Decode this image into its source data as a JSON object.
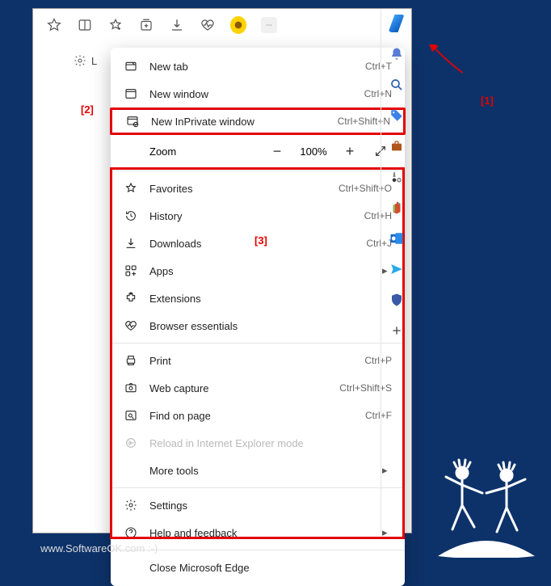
{
  "toolbar_icons": [
    "star-icon",
    "split-screen-icon",
    "favorites-star-icon",
    "collections-icon",
    "download-icon",
    "health-icon",
    "sunflower-icon",
    "more-icon",
    "copilot-icon"
  ],
  "peek": {
    "gear": true,
    "letter": "L"
  },
  "menu": {
    "items": [
      {
        "icon": "new-tab-icon",
        "label": "New tab",
        "shortcut": "Ctrl+T"
      },
      {
        "icon": "new-window-icon",
        "label": "New window",
        "shortcut": "Ctrl+N"
      },
      {
        "icon": "inprivate-icon",
        "label": "New InPrivate window",
        "shortcut": "Ctrl+Shift+N",
        "highlight": true
      },
      {
        "type": "zoom",
        "label": "Zoom",
        "value": "100%"
      },
      {
        "type": "sep"
      },
      {
        "icon": "favorites-icon",
        "label": "Favorites",
        "shortcut": "Ctrl+Shift+O"
      },
      {
        "icon": "history-icon",
        "label": "History",
        "shortcut": "Ctrl+H"
      },
      {
        "icon": "download-icon",
        "label": "Downloads",
        "shortcut": "Ctrl+J"
      },
      {
        "icon": "apps-icon",
        "label": "Apps",
        "submenu": true
      },
      {
        "icon": "extensions-icon",
        "label": "Extensions"
      },
      {
        "icon": "essentials-icon",
        "label": "Browser essentials"
      },
      {
        "type": "sep"
      },
      {
        "icon": "print-icon",
        "label": "Print",
        "shortcut": "Ctrl+P"
      },
      {
        "icon": "capture-icon",
        "label": "Web capture",
        "shortcut": "Ctrl+Shift+S"
      },
      {
        "icon": "find-icon",
        "label": "Find on page",
        "shortcut": "Ctrl+F"
      },
      {
        "icon": "ie-icon",
        "label": "Reload in Internet Explorer mode",
        "disabled": true
      },
      {
        "indent": true,
        "label": "More tools",
        "submenu": true
      },
      {
        "type": "sep"
      },
      {
        "icon": "settings-icon",
        "label": "Settings"
      },
      {
        "icon": "help-icon",
        "label": "Help and feedback",
        "submenu": true
      },
      {
        "type": "sep"
      },
      {
        "indent": true,
        "label": "Close Microsoft Edge"
      }
    ]
  },
  "sidebar_icons": [
    "copilot-icon",
    "bell-icon",
    "search-icon",
    "tag-icon",
    "briefcase-icon",
    "games-icon",
    "microsoft365-icon",
    "outlook-icon",
    "send-icon",
    "shield-icon",
    "plus-icon"
  ],
  "annotations": {
    "a1": "[1]",
    "a2": "[2]",
    "a3": "[3]"
  },
  "watermark": "www.SoftwareOK.com :-)",
  "watermark2": "www.SoftwareOK.com"
}
